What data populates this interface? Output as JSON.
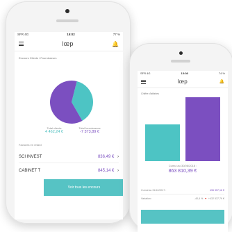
{
  "phone1": {
    "status": {
      "left": "SFR 4G",
      "time": "15:02",
      "right": "77 %"
    },
    "logo": "lœp",
    "section_title": "Encours Clients / Fournisseurs",
    "pie": {
      "slices": [
        {
          "name": "Total clients",
          "value": 4462.24,
          "color": "#4dc4c4"
        },
        {
          "name": "Total fournisseurs",
          "value": 7373.89,
          "color": "#7b4fc0"
        }
      ]
    },
    "totals": {
      "clients_label": "Total clients",
      "clients_value": "4 462,24 €",
      "fournisseurs_label": "Total fournisseurs",
      "fournisseurs_value": "-7 373,89 €"
    },
    "late_label": "Factures en retard",
    "accounts": [
      {
        "name": "SCI INVEST",
        "amount": "836,49 €",
        "chevron": "›"
      },
      {
        "name": "CABINET T",
        "amount": "845,14 €",
        "chevron": "›"
      }
    ],
    "cta": "Voir tous les encours"
  },
  "phone2": {
    "status": {
      "left": "SFR 4G",
      "time": "15:08",
      "right": "74 %"
    },
    "logo": "lœp",
    "section_title": "Chiffre d'affaires",
    "chart_data": {
      "type": "bar",
      "categories": [
        "Cumul au 31/12/2017",
        "Cumul au 30/06/2018"
      ],
      "values": [
        496357.16,
        863810.39
      ],
      "colors": [
        "#4dc4c4",
        "#7b4fc0"
      ],
      "title": "",
      "xlabel": "",
      "ylabel": ""
    },
    "cumul_label": "Cumul au 30/06/2018 :",
    "cumul_value": "863 810,39 €",
    "rows": [
      {
        "label": "Cumul au 31/12/2017 :",
        "value": "496 357,16 €"
      },
      {
        "label": "Variation :",
        "pct": "-40,4 %",
        "arrow": "▼",
        "value": "+432 537,79 €"
      }
    ]
  }
}
